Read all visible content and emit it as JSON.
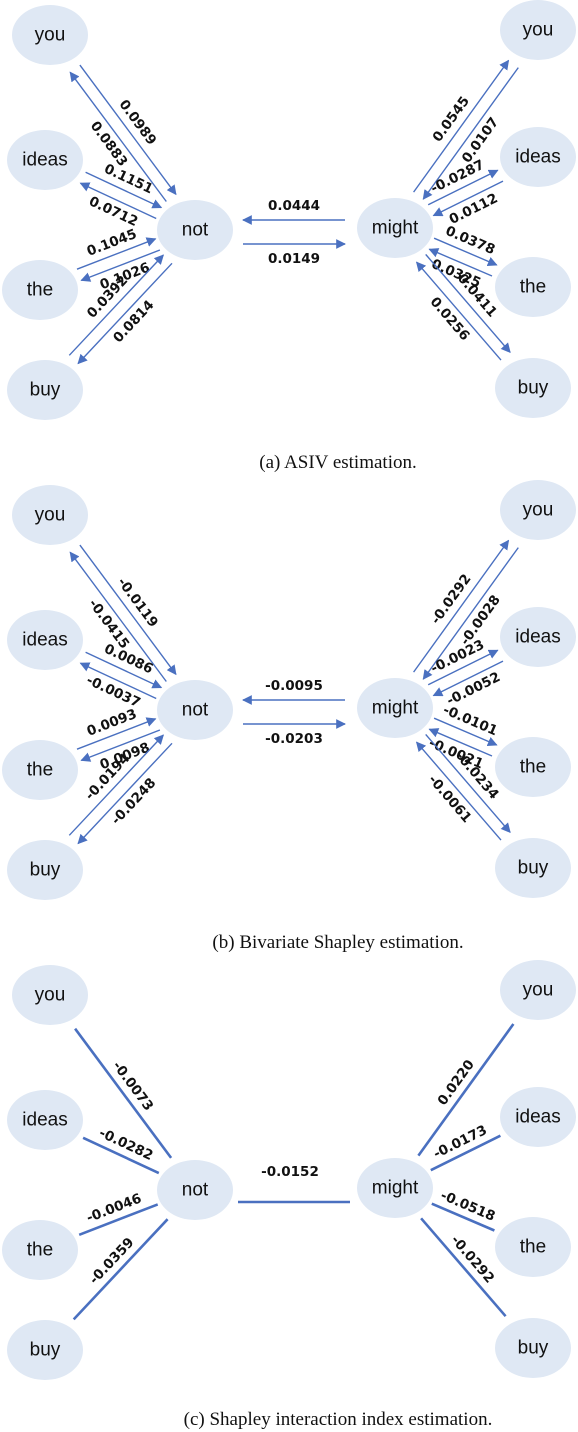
{
  "figure": {
    "panels": [
      {
        "id": "a",
        "caption": "(a) ASIV estimation.",
        "edge_style": "directed-pairs",
        "center_left": "not",
        "center_right": "might",
        "left_words": [
          "you",
          "ideas",
          "the",
          "buy"
        ],
        "right_words": [
          "you",
          "ideas",
          "the",
          "buy"
        ],
        "center_edges": {
          "might_to_not": "0.0444",
          "not_to_might": "0.0149"
        },
        "left_edges": [
          {
            "word": "you",
            "not_to_word": "0.0883",
            "word_to_not": "0.0989"
          },
          {
            "word": "ideas",
            "not_to_word": "0.0712",
            "word_to_not": "0.1151"
          },
          {
            "word": "the",
            "not_to_word": "0.1026",
            "word_to_not": "0.1045"
          },
          {
            "word": "buy",
            "not_to_word": "0.0814",
            "word_to_not": "0.0392"
          }
        ],
        "right_edges": [
          {
            "word": "you",
            "word_to_might": "0.0107",
            "might_to_word": "0.0545"
          },
          {
            "word": "ideas",
            "word_to_might": "0.0112",
            "might_to_word": "-0.0287"
          },
          {
            "word": "the",
            "word_to_might": "0.0325",
            "might_to_word": "0.0378"
          },
          {
            "word": "buy",
            "word_to_might": "0.0256",
            "might_to_word": "0.0411"
          }
        ]
      },
      {
        "id": "b",
        "caption": "(b) Bivariate Shapley estimation.",
        "edge_style": "directed-pairs",
        "center_left": "not",
        "center_right": "might",
        "left_words": [
          "you",
          "ideas",
          "the",
          "buy"
        ],
        "right_words": [
          "you",
          "ideas",
          "the",
          "buy"
        ],
        "center_edges": {
          "might_to_not": "-0.0095",
          "not_to_might": "-0.0203"
        },
        "left_edges": [
          {
            "word": "you",
            "not_to_word": "-0.0415",
            "word_to_not": "-0.0119"
          },
          {
            "word": "ideas",
            "not_to_word": "-0.0037",
            "word_to_not": "0.0086"
          },
          {
            "word": "the",
            "not_to_word": "0.0098",
            "word_to_not": "0.0093"
          },
          {
            "word": "buy",
            "not_to_word": "-0.0248",
            "word_to_not": "-0.0194"
          }
        ],
        "right_edges": [
          {
            "word": "you",
            "word_to_might": "-0.0028",
            "might_to_word": "-0.0292"
          },
          {
            "word": "ideas",
            "word_to_might": "-0.0052",
            "might_to_word": "-0.0023"
          },
          {
            "word": "the",
            "word_to_might": "-0.0021",
            "might_to_word": "-0.0101"
          },
          {
            "word": "buy",
            "word_to_might": "-0.0061",
            "might_to_word": "-0.0234"
          }
        ]
      },
      {
        "id": "c",
        "caption": "(c) Shapley interaction index estimation.",
        "edge_style": "undirected",
        "center_left": "not",
        "center_right": "might",
        "left_words": [
          "you",
          "ideas",
          "the",
          "buy"
        ],
        "right_words": [
          "you",
          "ideas",
          "the",
          "buy"
        ],
        "center_edges": {
          "not_might": "-0.0152"
        },
        "left_edges": [
          {
            "word": "you",
            "value": "-0.0073"
          },
          {
            "word": "ideas",
            "value": "-0.0282"
          },
          {
            "word": "the",
            "value": "-0.0046"
          },
          {
            "word": "buy",
            "value": "-0.0359"
          }
        ],
        "right_edges": [
          {
            "word": "you",
            "value": "0.0220"
          },
          {
            "word": "ideas",
            "value": "-0.0173"
          },
          {
            "word": "the",
            "value": "-0.0518"
          },
          {
            "word": "buy",
            "value": "-0.0292"
          }
        ]
      }
    ],
    "colors": {
      "node_fill": "#dfe8f4",
      "edge": "#4a70c0",
      "text": "#111111"
    }
  }
}
